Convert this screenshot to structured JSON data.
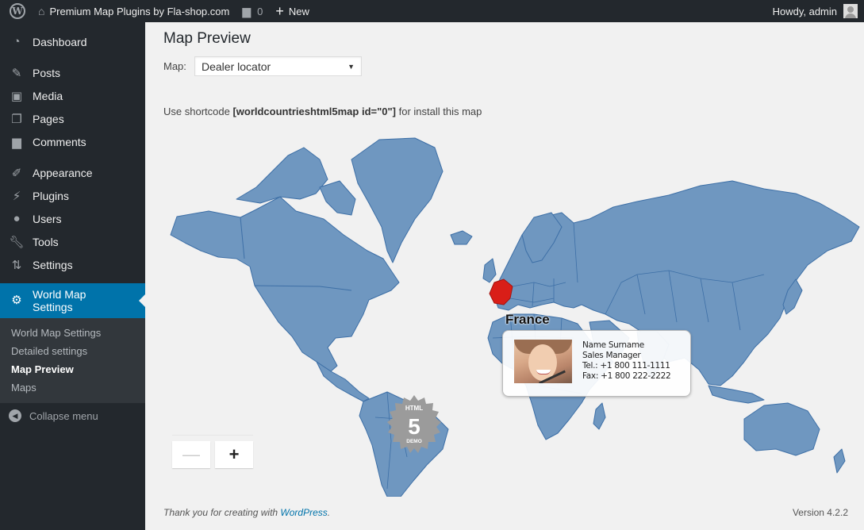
{
  "adminbar": {
    "site_name": "Premium Map Plugins by Fla-shop.com",
    "comments_count": "0",
    "new_label": "New",
    "greeting": "Howdy, admin"
  },
  "sidebar": {
    "items": [
      {
        "label": "Dashboard",
        "icon": "dashboard-icon"
      },
      {
        "label": "Posts",
        "icon": "pin-icon"
      },
      {
        "label": "Media",
        "icon": "media-icon"
      },
      {
        "label": "Pages",
        "icon": "pages-icon"
      },
      {
        "label": "Comments",
        "icon": "comment-icon"
      },
      {
        "label": "Appearance",
        "icon": "paintbrush-icon"
      },
      {
        "label": "Plugins",
        "icon": "plugin-icon"
      },
      {
        "label": "Users",
        "icon": "user-icon"
      },
      {
        "label": "Tools",
        "icon": "wrench-icon"
      },
      {
        "label": "Settings",
        "icon": "settings-icon"
      }
    ],
    "active": {
      "label": "World Map Settings",
      "icon": "gear-icon"
    },
    "submenu": [
      "World Map Settings",
      "Detailed settings",
      "Map Preview",
      "Maps"
    ],
    "current_submenu": "Map Preview",
    "collapse_label": "Collapse menu"
  },
  "main": {
    "title": "Map Preview",
    "map_label": "Map:",
    "map_select_value": "Dealer locator",
    "shortcode_prefix": "Use shortcode ",
    "shortcode": "[worldcountrieshtml5map id=\"0\"]",
    "shortcode_suffix": " for install this map"
  },
  "map": {
    "land_color": "#6f97c0",
    "border_color": "#3d6fa6",
    "highlight_color": "#d91e18",
    "highlighted_country": "France",
    "tooltip": {
      "name": "Name Surname",
      "role": "Sales Manager",
      "tel": "Tel.: +1 800 111-1111",
      "fax": "Fax: +1 800 222-2222"
    },
    "badge": {
      "top": "HTML",
      "middle": "5",
      "bottom": "DEMO"
    },
    "zoom_out": "—",
    "zoom_in": "+"
  },
  "footer": {
    "thanks_prefix": "Thank you for creating with ",
    "wordpress_link": "WordPress",
    "thanks_suffix": ".",
    "version": "Version 4.2.2"
  }
}
